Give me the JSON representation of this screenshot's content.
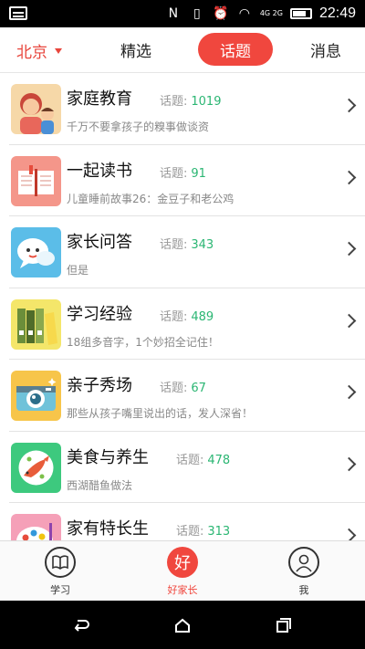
{
  "status_bar": {
    "time": "22:49",
    "nfc": "N",
    "network": "4G 2G"
  },
  "top_nav": {
    "city": "北京",
    "tabs": [
      {
        "label": "精选",
        "active": false
      },
      {
        "label": "话题",
        "active": true
      },
      {
        "label": "消息",
        "active": false
      }
    ]
  },
  "topics": [
    {
      "title": "家庭教育",
      "count_label": "话题:",
      "count": "1019",
      "subtitle": "千万不要拿孩子的糗事做谈资",
      "icon": "family-icon",
      "thumb_color": "#f6d8a8"
    },
    {
      "title": "一起读书",
      "count_label": "话题:",
      "count": "91",
      "subtitle": "儿童睡前故事26：金豆子和老公鸡",
      "icon": "book-icon",
      "thumb_color": "#f4968a"
    },
    {
      "title": "家长问答",
      "count_label": "话题:",
      "count": "343",
      "subtitle": "但是",
      "icon": "chat-bubble-icon",
      "thumb_color": "#5bbde8"
    },
    {
      "title": "学习经验",
      "count_label": "话题:",
      "count": "489",
      "subtitle": "18组多音字，1个妙招全记住！",
      "icon": "binders-icon",
      "thumb_color": "#f4e66a"
    },
    {
      "title": "亲子秀场",
      "count_label": "话题:",
      "count": "67",
      "subtitle": "那些从孩子嘴里说出的话，发人深省！",
      "icon": "camera-icon",
      "thumb_color": "#f7c54a"
    },
    {
      "title": "美食与养生",
      "count_label": "话题:",
      "count": "478",
      "subtitle": "西湖醋鱼做法",
      "icon": "fish-plate-icon",
      "thumb_color": "#3dc97e"
    },
    {
      "title": "家有特长生",
      "count_label": "话题:",
      "count": "313",
      "subtitle": "",
      "icon": "palette-icon",
      "thumb_color": "#f5a0b8"
    }
  ],
  "bottom_nav": [
    {
      "label": "学习",
      "icon": "book-outline-icon",
      "active": false
    },
    {
      "label": "好家长",
      "icon": "hao-icon",
      "glyph": "好",
      "active": true
    },
    {
      "label": "我",
      "icon": "user-icon",
      "active": false
    }
  ],
  "colors": {
    "accent": "#f0473e",
    "count": "#2bb673",
    "city": "#e8453c"
  }
}
